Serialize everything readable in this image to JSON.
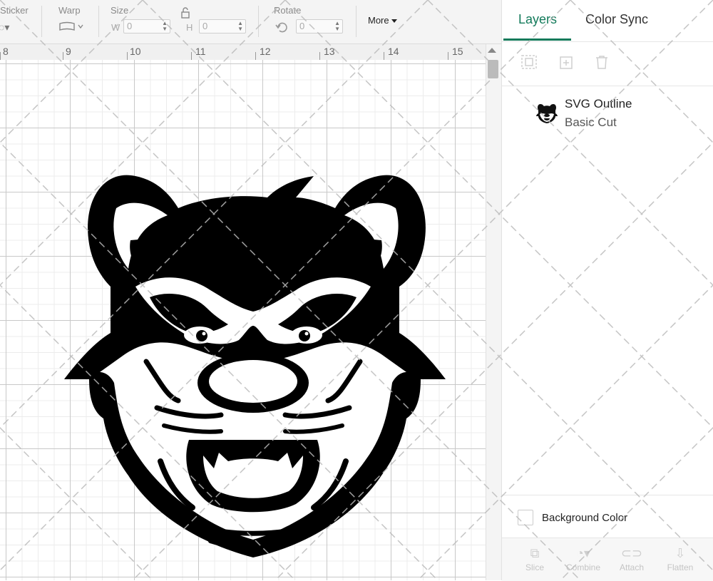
{
  "toolbar": {
    "sticker_label": "Sticker",
    "warp_label": "Warp",
    "size_label": "Size",
    "rotate_label": "Rotate",
    "w_label": "W",
    "h_label": "H",
    "width_value": "0",
    "height_value": "0",
    "rotate_value": "0",
    "more_label": "More"
  },
  "ruler": {
    "marks": [
      "8",
      "9",
      "10",
      "11",
      "12",
      "13",
      "14",
      "15"
    ]
  },
  "panel": {
    "tabs": [
      {
        "label": "Layers",
        "active": true
      },
      {
        "label": "Color Sync",
        "active": false
      }
    ],
    "layer": {
      "name": "SVG Outline",
      "operation": "Basic Cut"
    },
    "background_label": "Background Color",
    "bottom_tools": [
      "Slice",
      "Combine",
      "Attach",
      "Flatten"
    ]
  },
  "colors": {
    "accent": "#127a5a",
    "design": "#000000"
  }
}
